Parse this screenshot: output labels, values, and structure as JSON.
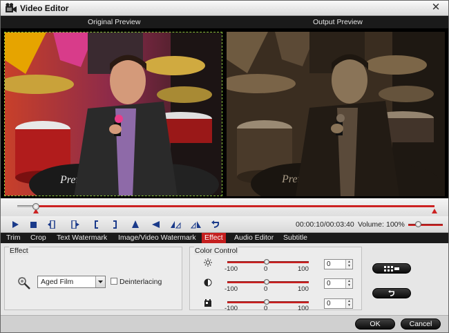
{
  "window": {
    "title": "Video Editor",
    "close_label": "✕"
  },
  "preview": {
    "original_label": "Original Preview",
    "output_label": "Output Preview"
  },
  "playback": {
    "time": "00:00:10/00:03:40",
    "volume_label": "Volume:",
    "volume_value": "100%",
    "volume_level": 1.0
  },
  "tabs": [
    {
      "label": "Trim",
      "active": false
    },
    {
      "label": "Crop",
      "active": false
    },
    {
      "label": "Text Watermark",
      "active": false
    },
    {
      "label": "Image/Video Watermark",
      "active": false
    },
    {
      "label": "Effect",
      "active": true
    },
    {
      "label": "Audio Editor",
      "active": false
    },
    {
      "label": "Subtitle",
      "active": false
    }
  ],
  "effect": {
    "group_title": "Effect",
    "selected": "Aged Film",
    "deinterlacing_label": "Deinterlacing",
    "deinterlacing_checked": false
  },
  "color_control": {
    "group_title": "Color Control",
    "rows": [
      {
        "name": "brightness",
        "min": "-100",
        "mid": "0",
        "max": "100",
        "value": "0"
      },
      {
        "name": "contrast",
        "min": "-100",
        "mid": "0",
        "max": "100",
        "value": "0"
      },
      {
        "name": "saturation",
        "min": "-100",
        "mid": "0",
        "max": "100",
        "value": "0"
      }
    ]
  },
  "buttons": {
    "ok": "OK",
    "cancel": "Cancel"
  },
  "icons": [
    "film-icon",
    "play-icon",
    "stop-icon",
    "prev-frame-icon",
    "next-frame-icon",
    "mark-in-icon",
    "mark-out-icon",
    "flip-vertical-icon",
    "flip-horizontal-icon",
    "rotate-left-icon",
    "rotate-right-icon",
    "undo-icon",
    "magic-wand-icon",
    "brightness-icon",
    "contrast-icon",
    "saturation-icon",
    "apply-to-all-icon",
    "reset-icon"
  ]
}
